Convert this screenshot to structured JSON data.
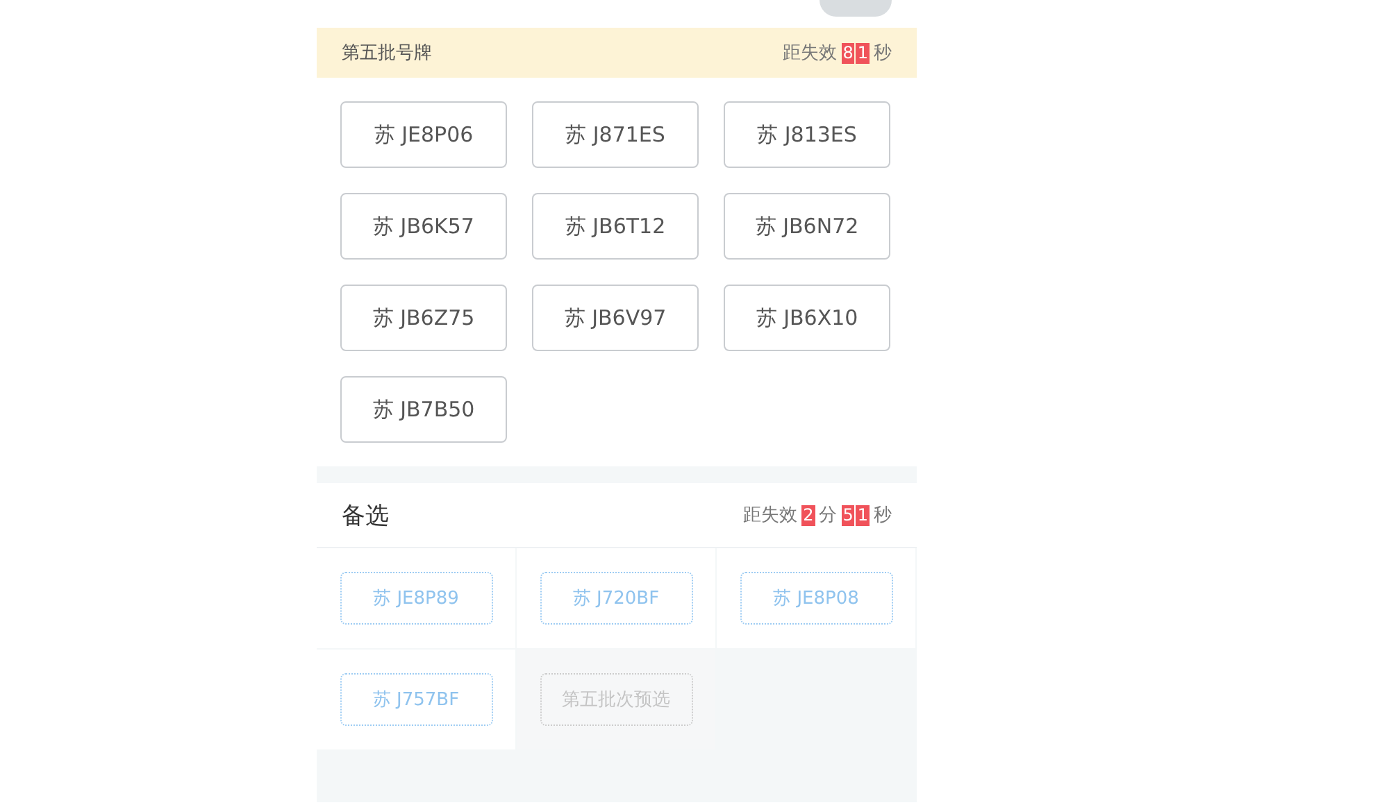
{
  "batch": {
    "title": "第五批号牌",
    "countdown": {
      "prefix": "距失效",
      "parts": [
        {
          "digits": [
            "8",
            "1"
          ],
          "unit": "秒"
        }
      ]
    }
  },
  "plates": [
    "苏 JE8P06",
    "苏 J871ES",
    "苏 J813ES",
    "苏 JB6K57",
    "苏 JB6T12",
    "苏 JB6N72",
    "苏 JB6Z75",
    "苏 JB6V97",
    "苏 JB6X10",
    "苏 JB7B50"
  ],
  "alternates": {
    "title": "备选",
    "countdown": {
      "prefix": "距失效",
      "parts": [
        {
          "digits": [
            "2"
          ],
          "unit": "分"
        },
        {
          "digits": [
            "5",
            "1"
          ],
          "unit": "秒"
        }
      ]
    },
    "items": [
      {
        "kind": "plate",
        "label": "苏 JE8P89"
      },
      {
        "kind": "plate",
        "label": "苏 J720BF"
      },
      {
        "kind": "plate",
        "label": "苏 JE8P08"
      },
      {
        "kind": "plate",
        "label": "苏 J757BF"
      },
      {
        "kind": "preselect",
        "label": "第五批次预选"
      }
    ]
  }
}
